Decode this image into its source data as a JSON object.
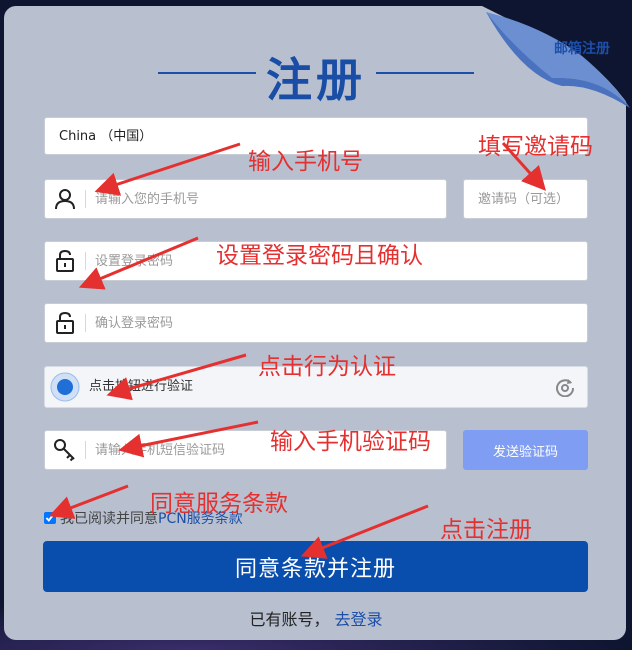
{
  "header": {
    "title": "注册",
    "corner_link": "邮箱注册"
  },
  "form": {
    "country": "China （中国）",
    "phone_placeholder": "请输入您的手机号",
    "invite_placeholder": "邀请码（可选）",
    "password_placeholder": "设置登录密码",
    "confirm_placeholder": "确认登录密码",
    "captcha_label": "点击按钮进行验证",
    "sms_placeholder": "请输入手机短信验证码",
    "send_code_label": "发送验证码",
    "agree_prefix": "我已阅读并同意",
    "agree_link": "PCN服务条款",
    "agree_checked": true,
    "submit_label": "同意条款并注册",
    "login_prompt": "已有账号，",
    "login_link": "去登录"
  },
  "annotations": {
    "phone": "输入手机号",
    "invite": "填写邀请码",
    "password": "设置登录密码且确认",
    "captcha": "点击行为认证",
    "sms": "输入手机验证码",
    "terms": "同意服务条款",
    "submit": "点击注册"
  },
  "colors": {
    "primary": "#0a4ead",
    "send_button": "#7f9df2",
    "annotation": "#e53030",
    "card": "#b8c0d0"
  }
}
